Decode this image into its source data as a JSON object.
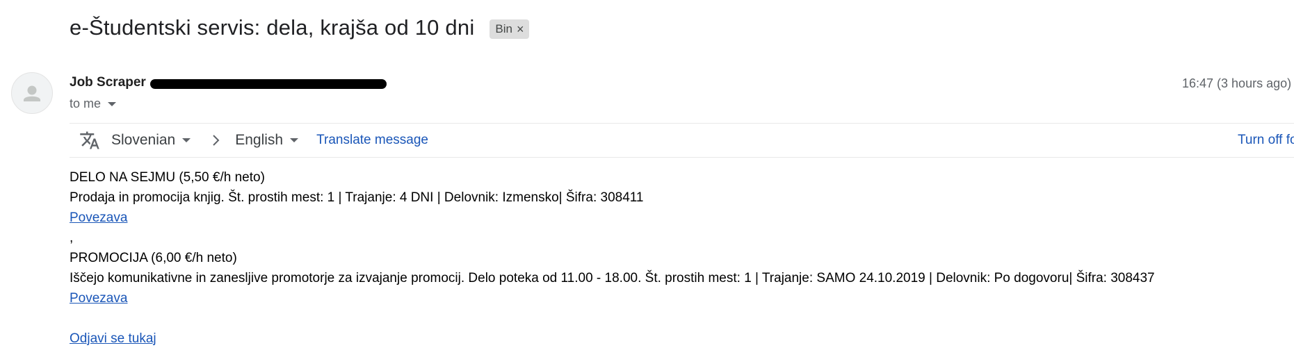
{
  "subject": "e-Študentski servis: dela, krajša od 10 dni",
  "label_chip": {
    "label": "Bin",
    "close": "×"
  },
  "sender": {
    "name": "Job Scraper"
  },
  "timestamp": "16:47 (3 hours ago)",
  "recipient": "to me",
  "translate": {
    "from_lang": "Slovenian",
    "to_lang": "English",
    "action": "Translate message",
    "turn_off": "Turn off fo"
  },
  "body": {
    "job1": {
      "title": "DELO NA SEJMU (5,50 €/h neto)",
      "details": "Prodaja in promocija knjig. Št. prostih mest: 1 | Trajanje: 4 DNI | Delovnik: Izmensko| Šifra: 308411",
      "link": "Povezava"
    },
    "separator": ",",
    "job2": {
      "title": "PROMOCIJA (6,00 €/h neto)",
      "details": "Iščejo komunikativne in zanesljive promotorje za izvajanje promocij. Delo poteka od 11.00 - 18.00. Št. prostih mest: 1 | Trajanje: SAMO 24.10.2019 | Delovnik: Po dogovoru| Šifra: 308437",
      "link": "Povezava"
    },
    "unsubscribe": "Odjavi se tukaj"
  },
  "colors": {
    "link": "#1a56b8",
    "chip_bg": "#dddddd",
    "muted_text": "#5f6368",
    "redaction": "#000000"
  },
  "icons": [
    "person-avatar-icon",
    "translate-icon",
    "chevron-right-icon",
    "dropdown-caret-icon",
    "close-icon"
  ]
}
